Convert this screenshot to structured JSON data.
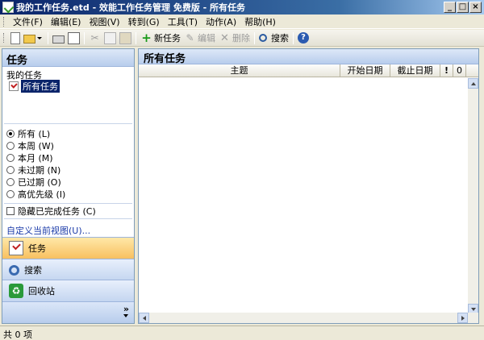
{
  "window": {
    "title": "我的工作任务.etd - 效能工作任务管理 免费版 - 所有任务",
    "controls": [
      "_",
      "□",
      "×"
    ]
  },
  "menu": [
    {
      "label": "文件(F)"
    },
    {
      "label": "编辑(E)"
    },
    {
      "label": "视图(V)"
    },
    {
      "label": "转到(G)"
    },
    {
      "label": "工具(T)"
    },
    {
      "label": "动作(A)"
    },
    {
      "label": "帮助(H)"
    }
  ],
  "toolbar": {
    "new_task": "新任务",
    "edit": "编辑",
    "delete": "删除",
    "search": "搜索"
  },
  "left_pane": {
    "header": "任务",
    "my_tasks_label": "我的任务",
    "tree_item": "所有任务",
    "filters": [
      {
        "label": "所有 (L)",
        "selected": true
      },
      {
        "label": "本周 (W)",
        "selected": false
      },
      {
        "label": "本月 (M)",
        "selected": false
      },
      {
        "label": "未过期 (N)",
        "selected": false
      },
      {
        "label": "已过期 (O)",
        "selected": false
      },
      {
        "label": "高优先级 (I)",
        "selected": false
      }
    ],
    "hide_completed": "隐藏已完成任务 (C)",
    "customize_view": "自定义当前视图(U)...",
    "splitter": "••••••••",
    "nav": [
      {
        "label": "任务",
        "active": true
      },
      {
        "label": "搜索",
        "active": false
      },
      {
        "label": "回收站",
        "active": false
      }
    ],
    "more": "»"
  },
  "right_pane": {
    "header": "所有任务",
    "columns": [
      "主题",
      "开始日期",
      "截止日期",
      "!",
      "0"
    ]
  },
  "status": {
    "text": "共 0 项"
  }
}
